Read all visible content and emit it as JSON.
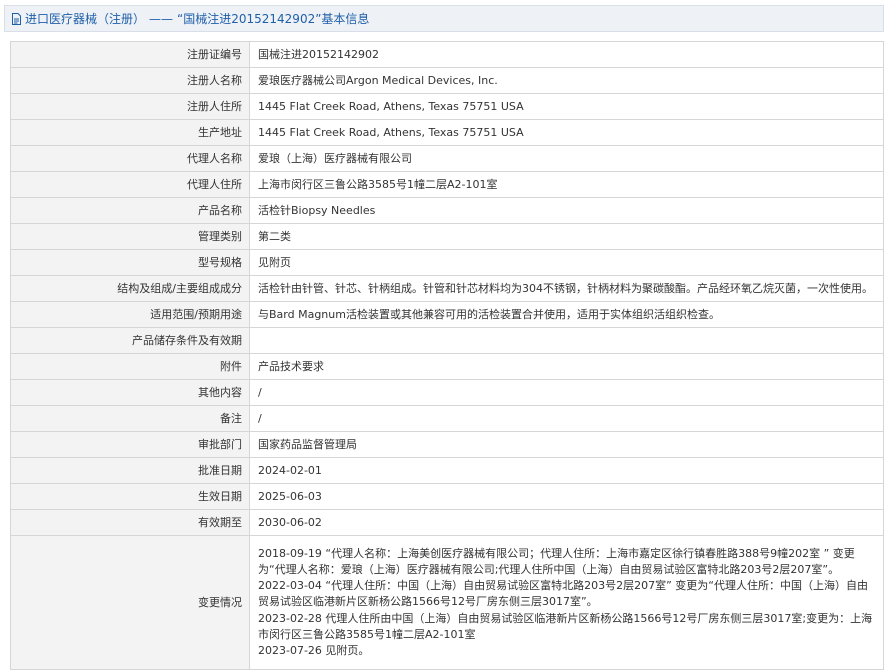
{
  "header": {
    "category": "进口医疗器械（注册）",
    "separator": "——",
    "reg_title": "“国械注进20152142902”基本信息"
  },
  "rows": [
    {
      "label": "注册证编号",
      "value": "国械注进20152142902"
    },
    {
      "label": "注册人名称",
      "value": "爱琅医疗器械公司Argon Medical Devices, Inc."
    },
    {
      "label": "注册人住所",
      "value": "1445 Flat Creek Road, Athens, Texas 75751 USA"
    },
    {
      "label": "生产地址",
      "value": "1445 Flat Creek Road, Athens, Texas 75751 USA"
    },
    {
      "label": "代理人名称",
      "value": "爱琅（上海）医疗器械有限公司"
    },
    {
      "label": "代理人住所",
      "value": "上海市闵行区三鲁公路3585号1幢二层A2-101室"
    },
    {
      "label": "产品名称",
      "value": "活检针Biopsy Needles"
    },
    {
      "label": "管理类别",
      "value": "第二类"
    },
    {
      "label": "型号规格",
      "value": "见附页"
    },
    {
      "label": "结构及组成/主要组成成分",
      "value": "活检针由针管、针芯、针柄组成。针管和针芯材料均为304不锈钢，针柄材料为聚碳酸酯。产品经环氧乙烷灭菌，一次性使用。"
    },
    {
      "label": "适用范围/预期用途",
      "value": "与Bard Magnum活检装置或其他兼容可用的活检装置合并使用，适用于实体组织活组织检查。"
    },
    {
      "label": "产品储存条件及有效期",
      "value": ""
    },
    {
      "label": "附件",
      "value": "产品技术要求"
    },
    {
      "label": "其他内容",
      "value": "/"
    },
    {
      "label": "备注",
      "value": "/"
    },
    {
      "label": "审批部门",
      "value": "国家药品监督管理局"
    },
    {
      "label": "批准日期",
      "value": "2024-02-01"
    },
    {
      "label": "生效日期",
      "value": "2025-06-03"
    },
    {
      "label": "有效期至",
      "value": "2030-06-02"
    }
  ],
  "change_history": {
    "label": "变更情况",
    "lines": [
      "2018-09-19 “代理人名称：上海美创医疗器械有限公司；代理人住所：上海市嘉定区徐行镇春胜路388号9幢202室 ” 变更为“代理人名称：爱琅（上海）医疗器械有限公司;代理人住所中国（上海）自由贸易试验区富特北路203号2层207室”。",
      "2022-03-04 “代理人住所：中国（上海）自由贸易试验区富特北路203号2层207室” 变更为“代理人住所：中国（上海）自由贸易试验区临港新片区新杨公路1566号12号厂房东侧三层3017室”。",
      "2023-02-28 代理人住所由中国（上海）自由贸易试验区临港新片区新杨公路1566号12号厂房东侧三层3017室;变更为：上海市闵行区三鲁公路3585号1幢二层A2-101室",
      "2023-07-26 见附页。"
    ]
  },
  "icons": {
    "header_icon": "document-icon"
  },
  "colors": {
    "header_text": "#1f5fa8",
    "header_bg": "#eef2f7",
    "label_bg": "#f3f3f3",
    "border": "#d6d6d6"
  }
}
